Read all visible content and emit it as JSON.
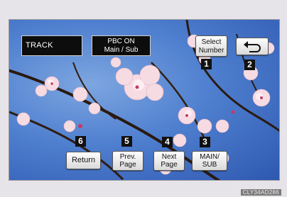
{
  "screen": {
    "track_label": "TRACK",
    "pbc_line1": "PBC  ON",
    "pbc_line2": "Main / Sub"
  },
  "buttons": {
    "select_number": [
      "Select",
      "Number"
    ],
    "back_icon": "back-arrow-icon",
    "return": "Return",
    "prev_page": [
      "Prev.",
      "Page"
    ],
    "next_page": [
      "Next",
      "Page"
    ],
    "main_sub": [
      "MAIN/",
      "SUB"
    ]
  },
  "callouts": [
    "1",
    "2",
    "3",
    "4",
    "5",
    "6"
  ],
  "caption": "CLY34AD286"
}
